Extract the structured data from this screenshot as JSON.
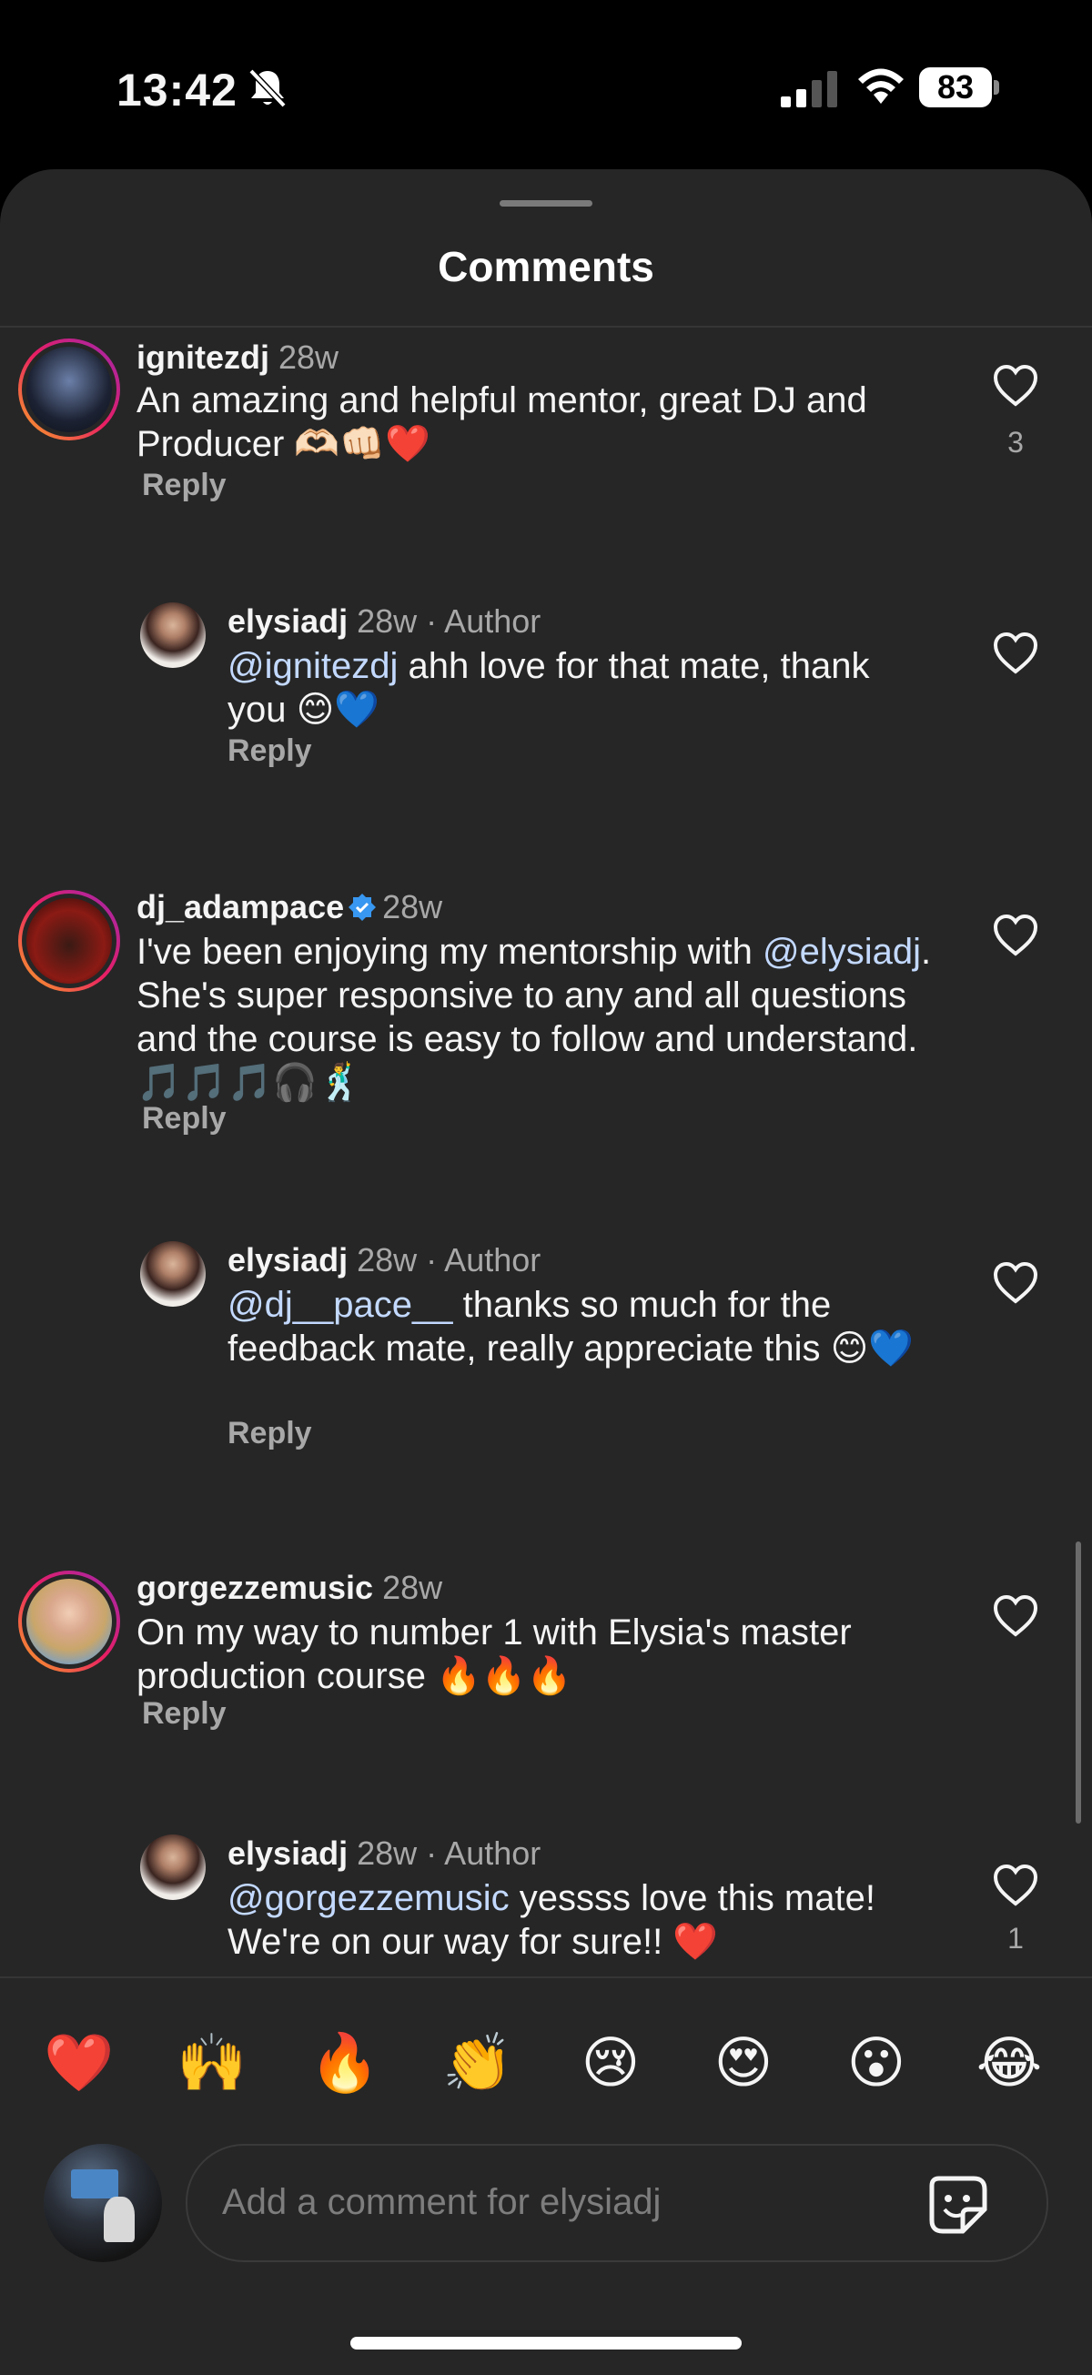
{
  "status": {
    "time": "13:42",
    "battery": "83"
  },
  "sheet": {
    "title": "Comments"
  },
  "comments": [
    {
      "user": "ignitezdj",
      "time": "28w",
      "author": "",
      "text_plain": "An amazing and helpful mentor, great DJ and Producer 🫶🏻👊🏻❤️",
      "mention": "",
      "text_after_mention": "",
      "reply": "Reply",
      "likes": "3"
    },
    {
      "user": "elysiadj",
      "time": "28w",
      "author": "· Author",
      "mention": "@ignitezdj",
      "text_after_mention": " ahh love for that mate, thank you 😊💙",
      "reply": "Reply",
      "likes": ""
    },
    {
      "user": "dj_adampace",
      "time": "28w",
      "author": "",
      "text_before": "I've been enjoying my mentorship with ",
      "mention": "@elysiadj",
      "text_after_mention": ". She's super responsive to any and all questions and the course is easy to follow and understand. 🎵🎵🎵🎧🕺",
      "reply": "Reply",
      "likes": ""
    },
    {
      "user": "elysiadj",
      "time": "28w",
      "author": "· Author",
      "mention": "@dj__pace__",
      "text_after_mention": " thanks so much for the feedback mate, really appreciate this 😊💙",
      "reply": "Reply",
      "likes": ""
    },
    {
      "user": "gorgezzemusic",
      "time": "28w",
      "author": "",
      "text_plain": "On my way to number 1 with Elysia's master production course 🔥🔥🔥",
      "reply": "Reply",
      "likes": ""
    },
    {
      "user": "elysiadj",
      "time": "28w",
      "author": "· Author",
      "mention": "@gorgezzemusic",
      "text_after_mention": " yessss love this mate! We're on our way for sure!! ❤️",
      "reply": "Reply",
      "likes": "1"
    }
  ],
  "reactions": [
    "❤️",
    "🙌",
    "🔥",
    "👏",
    "😢",
    "😍",
    "😮",
    "😂"
  ],
  "input": {
    "placeholder": "Add a comment for elysiadj"
  },
  "icons": {
    "heart": "heart-icon",
    "verified": "verified-badge-icon",
    "sticker": "sticker-icon",
    "bell": "bell-slash-icon"
  }
}
